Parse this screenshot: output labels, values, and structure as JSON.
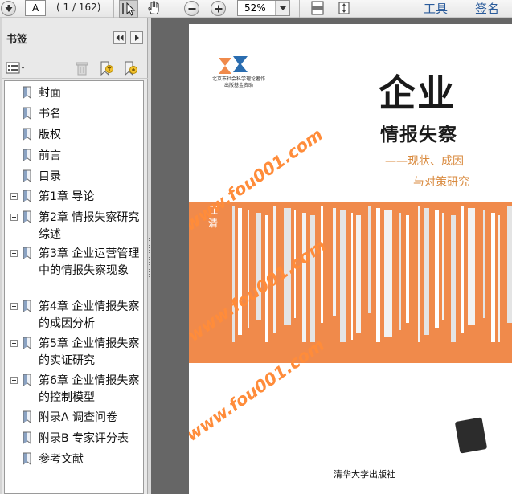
{
  "toolbar": {
    "page_value": "A",
    "page_count": "( 1 / 162)",
    "zoom_value": "52%",
    "tools_label": "工具",
    "sign_label": "签名"
  },
  "panel": {
    "title": "书签"
  },
  "bookmarks": [
    {
      "label": "封面",
      "expandable": false
    },
    {
      "label": "书名",
      "expandable": false
    },
    {
      "label": "版权",
      "expandable": false
    },
    {
      "label": "前言",
      "expandable": false
    },
    {
      "label": "目录",
      "expandable": false
    },
    {
      "label": "第1章  导论",
      "expandable": true
    },
    {
      "label": "第2章  情报失察研究综述",
      "expandable": true
    },
    {
      "label": "第3章  企业运营管理中的情报失察现象",
      "expandable": true
    },
    {
      "label": "第4章  企业情报失察的成因分析",
      "expandable": true
    },
    {
      "label": "第5章  企业情报失察的实证研究",
      "expandable": true
    },
    {
      "label": "第6章  企业情报失察的控制模型",
      "expandable": true
    },
    {
      "label": "附录A  调查问卷",
      "expandable": false
    },
    {
      "label": "附录B  专家评分表",
      "expandable": false
    },
    {
      "label": "参考文献",
      "expandable": false
    }
  ],
  "book": {
    "publisher_top_line1": "北京市社会科学理论著作",
    "publisher_top_line2": "出版基金资助",
    "title_main": "企业",
    "title_sub": "情报失察",
    "tagline1": "——现状、成因",
    "tagline2": "与对策研究",
    "author": "江清",
    "watermark": "www.fou001.com",
    "publisher_bottom": "清华大学出版社"
  },
  "colors": {
    "cover_orange": "#f08a4b",
    "watermark": "#ff8c3a",
    "link_blue": "#2a5b9b"
  }
}
